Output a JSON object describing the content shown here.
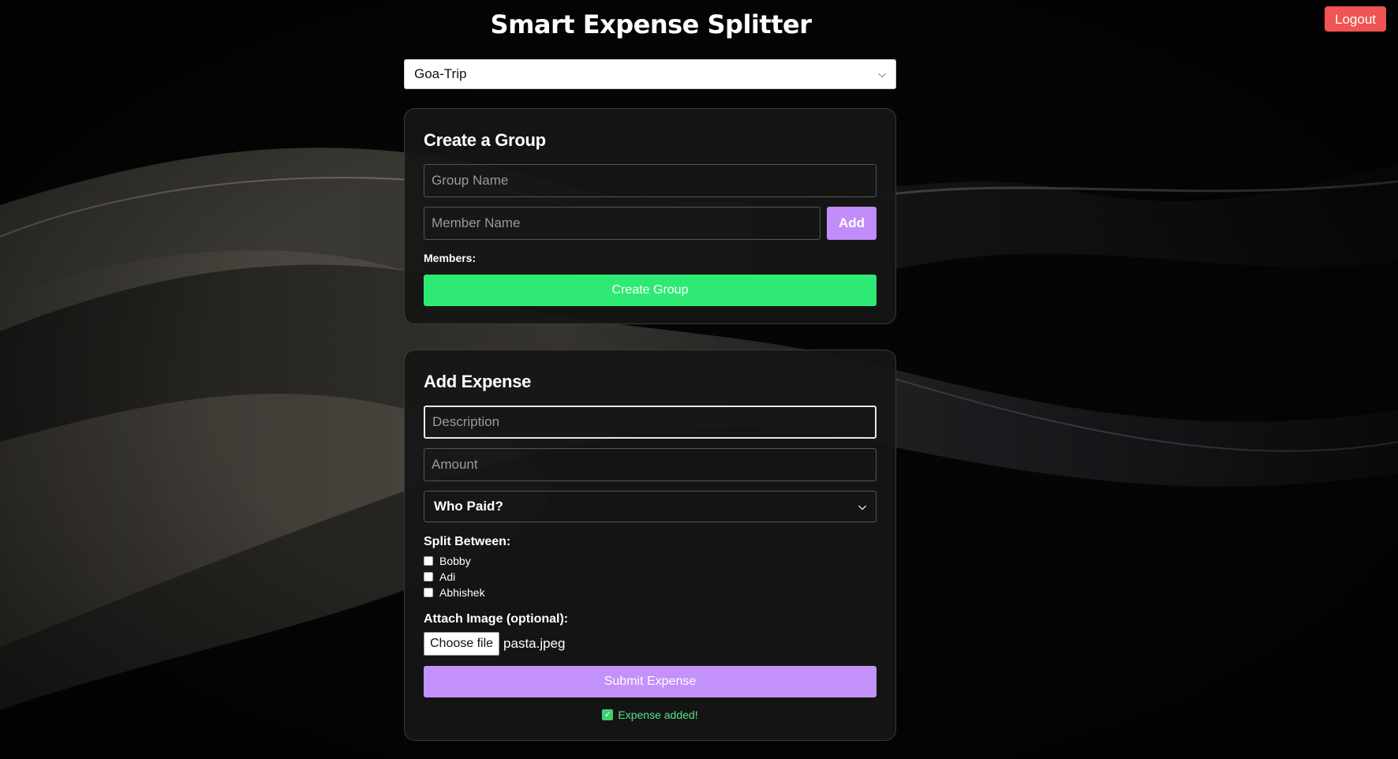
{
  "app": {
    "title": "Smart Expense Splitter",
    "logout_label": "Logout"
  },
  "group_select": {
    "selected": "Goa-Trip"
  },
  "create_group": {
    "heading": "Create a Group",
    "group_name_placeholder": "Group Name",
    "member_name_placeholder": "Member Name",
    "add_label": "Add",
    "members_label": "Members:",
    "create_label": "Create Group"
  },
  "add_expense": {
    "heading": "Add Expense",
    "description_placeholder": "Description",
    "amount_placeholder": "Amount",
    "who_paid": "Who Paid?",
    "split_label": "Split Between:",
    "members": [
      {
        "name": "Bobby",
        "checked": false
      },
      {
        "name": "Adi",
        "checked": false
      },
      {
        "name": "Abhishek",
        "checked": false
      }
    ],
    "attach_label": "Attach Image (optional):",
    "choose_file_label": "Choose file",
    "file_name": "pasta.jpeg",
    "submit_label": "Submit Expense",
    "status_text": "Expense added!"
  },
  "icons": {
    "dropdown": "chevron-down-icon",
    "status": "checkmark-icon"
  },
  "colors": {
    "logout": "#f05454",
    "add": "#c08cf8",
    "create_group": "#2eea74",
    "submit": "#c291fa",
    "status": "#59e38a"
  }
}
